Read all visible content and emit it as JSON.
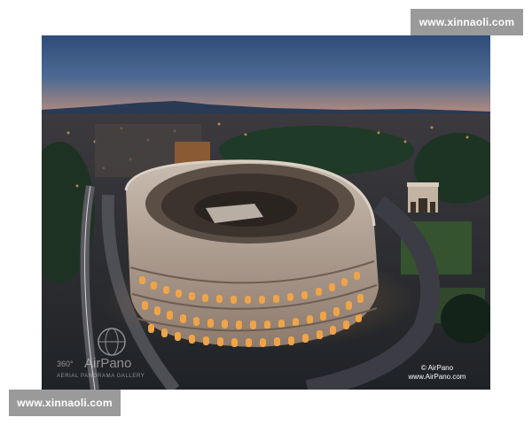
{
  "watermark_top": "www.xinnaoli.com",
  "watermark_bottom": "www.xinnaoli.com",
  "photo": {
    "subject": "Colosseum",
    "logo_left_top": "360°",
    "logo_left_brand": "AirPano",
    "logo_left_sub": "AERIAL PANORAMA GALLERY",
    "credit_line1": "© AirPano",
    "credit_line2": "www.AirPano.com"
  }
}
